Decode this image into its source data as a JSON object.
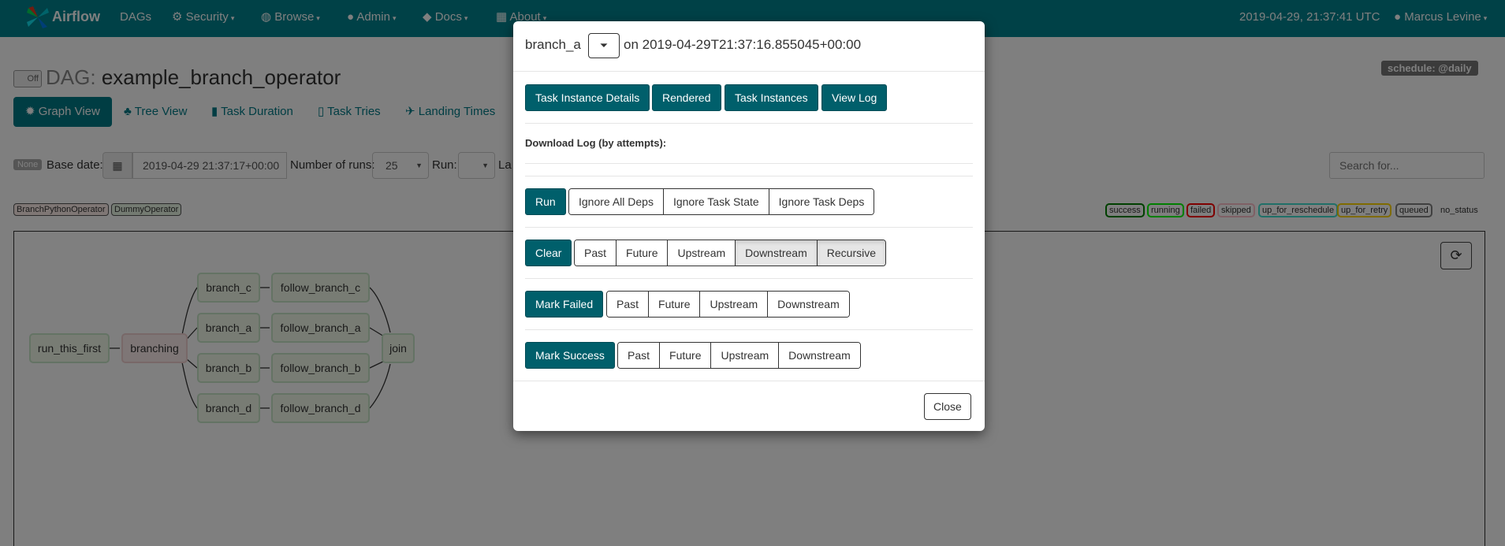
{
  "navbar": {
    "brand": "Airflow",
    "items": [
      {
        "label": "DAGs",
        "icon": ""
      },
      {
        "label": "Security",
        "icon": "gears-icon",
        "caret": "▾"
      },
      {
        "label": "Browse",
        "icon": "globe-icon",
        "caret": "▾"
      },
      {
        "label": "Admin",
        "icon": "user-icon",
        "caret": "▾"
      },
      {
        "label": "Docs",
        "icon": "cube-icon",
        "caret": "▾"
      },
      {
        "label": "About",
        "icon": "grid-icon",
        "caret": "▾"
      }
    ],
    "datetime": "2019-04-29, 21:37:41 UTC",
    "user": "Marcus Levine",
    "color": "#00838f"
  },
  "dag": {
    "toggle": "Off",
    "label": "DAG:",
    "name": "example_branch_operator",
    "schedule": "schedule: @daily"
  },
  "tabs": [
    "Graph View",
    "Tree View",
    "Task Duration",
    "Task Tries",
    "Landing Times"
  ],
  "controls": {
    "none_badge": "None",
    "base_date_label": "Base date:",
    "base_date_value": "2019-04-29 21:37:17+00:00",
    "runs_label": "Number of runs:",
    "runs_value": "25",
    "run_label": "Run:",
    "run_value": "",
    "layout_label": "La",
    "search_placeholder": "Search for..."
  },
  "operators": [
    "BranchPythonOperator",
    "DummyOperator"
  ],
  "legend": [
    {
      "label": "success",
      "color": "#008000"
    },
    {
      "label": "running",
      "color": "#00ff00"
    },
    {
      "label": "failed",
      "color": "#ff0000"
    },
    {
      "label": "skipped",
      "color": "#ffc0cb"
    },
    {
      "label": "up_for_reschedule",
      "color": "#40e0d0"
    },
    {
      "label": "up_for_retry",
      "color": "#ffd700"
    },
    {
      "label": "queued",
      "color": "#808080"
    },
    {
      "label": "no_status",
      "color": "#ffffff"
    }
  ],
  "graph": {
    "nodes": [
      "run_this_first",
      "branching",
      "branch_c",
      "branch_a",
      "branch_b",
      "branch_d",
      "follow_branch_c",
      "follow_branch_a",
      "follow_branch_b",
      "follow_branch_d",
      "join"
    ]
  },
  "modal": {
    "task": "branch_a",
    "on_text": "on 2019-04-29T21:37:16.855045+00:00",
    "filter_icon": "filter-icon",
    "top_buttons": [
      "Task Instance Details",
      "Rendered",
      "Task Instances",
      "View Log"
    ],
    "download_label": "Download Log (by attempts):",
    "run": {
      "label": "Run",
      "options": [
        "Ignore All Deps",
        "Ignore Task State",
        "Ignore Task Deps"
      ]
    },
    "clear": {
      "label": "Clear",
      "options": [
        "Past",
        "Future",
        "Upstream",
        "Downstream",
        "Recursive"
      ]
    },
    "mark_failed": {
      "label": "Mark Failed",
      "options": [
        "Past",
        "Future",
        "Upstream",
        "Downstream"
      ]
    },
    "mark_success": {
      "label": "Mark Success",
      "options": [
        "Past",
        "Future",
        "Upstream",
        "Downstream"
      ]
    },
    "close": "Close"
  }
}
